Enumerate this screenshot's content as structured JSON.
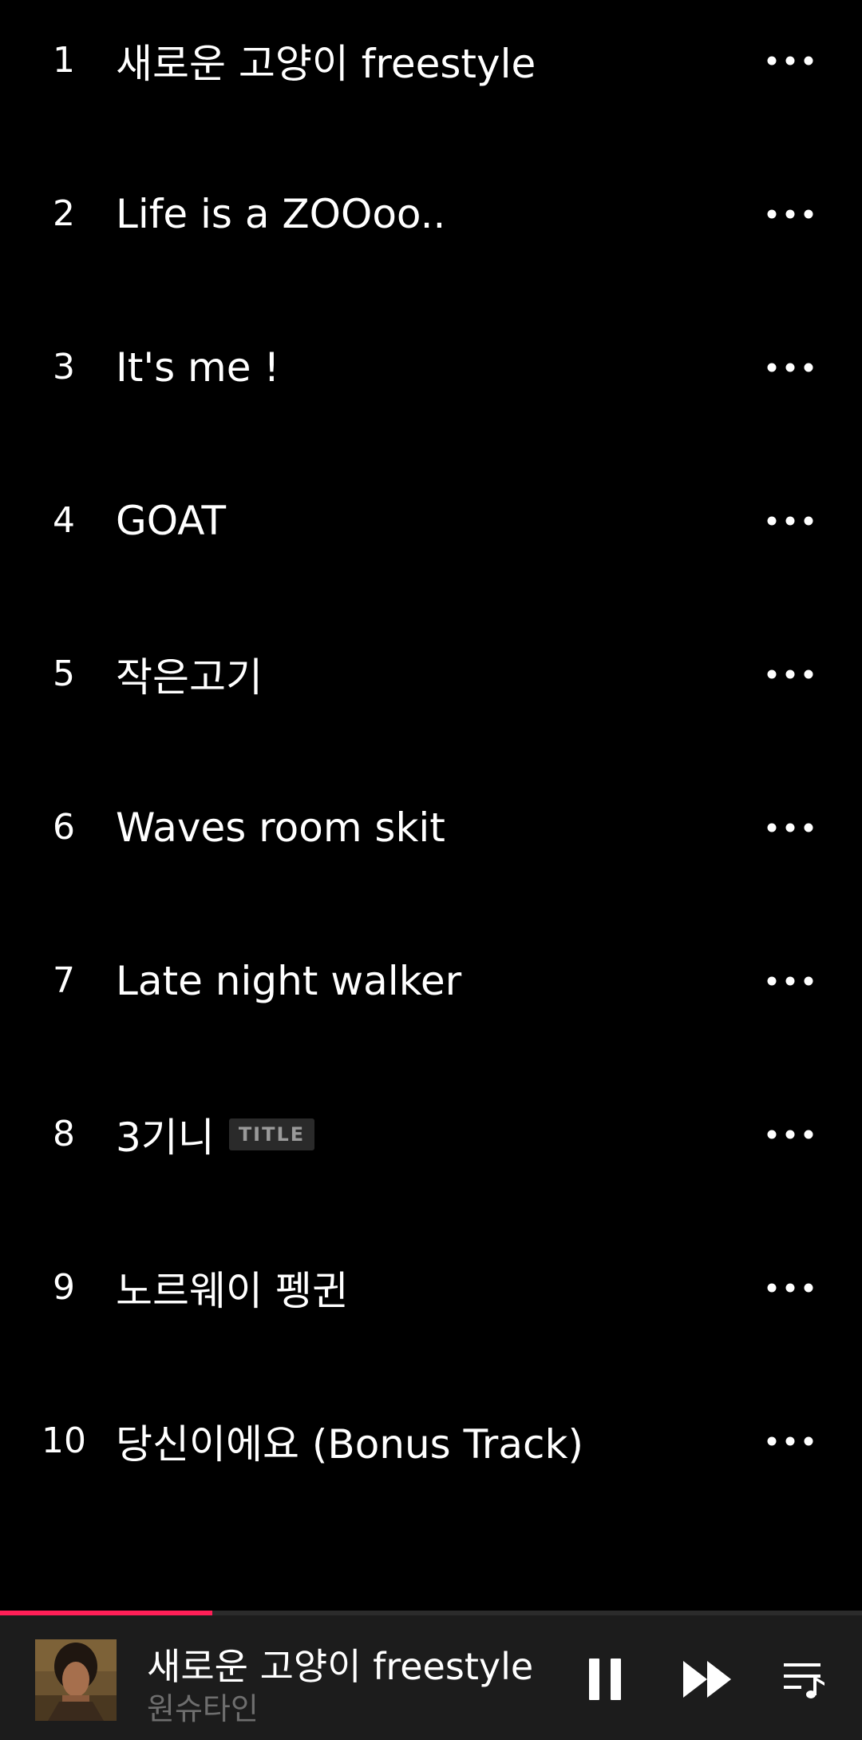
{
  "tracks": [
    {
      "number": "1",
      "title": "새로운 고양이 freestyle",
      "badge": ""
    },
    {
      "number": "2",
      "title": "Life is a ZOOoo..",
      "badge": ""
    },
    {
      "number": "3",
      "title": "It's me !",
      "badge": ""
    },
    {
      "number": "4",
      "title": "GOAT",
      "badge": ""
    },
    {
      "number": "5",
      "title": "작은고기",
      "badge": ""
    },
    {
      "number": "6",
      "title": "Waves room skit",
      "badge": ""
    },
    {
      "number": "7",
      "title": "Late night walker",
      "badge": ""
    },
    {
      "number": "8",
      "title": "3기니",
      "badge": "TITLE"
    },
    {
      "number": "9",
      "title": "노르웨이 펭귄",
      "badge": ""
    },
    {
      "number": "10",
      "title": "당신이에요 (Bonus Track)",
      "badge": ""
    }
  ],
  "player": {
    "title": "새로운 고양이 freestyle",
    "artist": "원슈타인",
    "progress": 0.246,
    "state": "playing"
  },
  "icons": {
    "more": "more-horizontal-icon",
    "pause": "pause-icon",
    "next": "fast-forward-icon",
    "queue": "playlist-queue-icon"
  },
  "colors": {
    "background": "#000000",
    "player_background": "#1c1c1c",
    "accent": "#ff1f57",
    "badge_background": "#2a2a2a",
    "badge_text": "#9a9a9a",
    "artist_text": "#6e6e6e"
  }
}
